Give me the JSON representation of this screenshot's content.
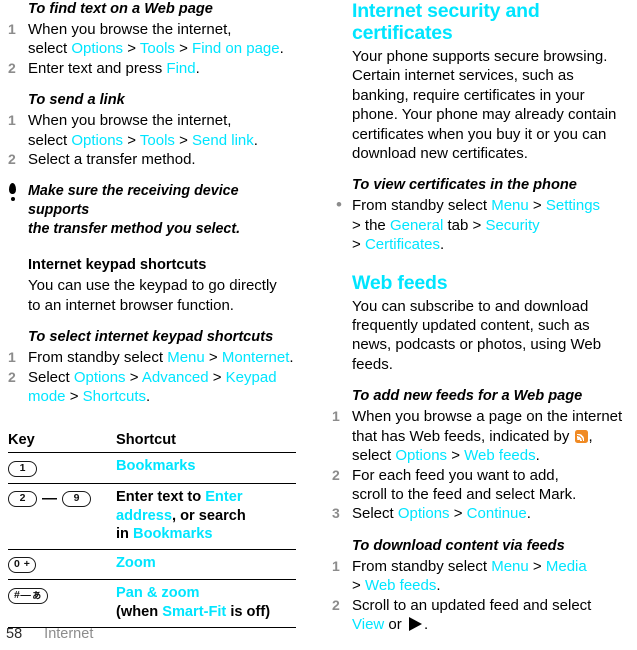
{
  "colors": {
    "accent_cyan": "#00e5ff",
    "step_number_gray": "#8c8c8c",
    "rss_orange": "#f08a24",
    "footer_gray": "#8c8c8c",
    "text_black": "#000000"
  },
  "left_column": {
    "proc_find_text": {
      "heading": "To find text on a Web page",
      "steps": [
        {
          "num": "1",
          "parts": [
            {
              "t": "When you browse the internet,",
              "style": "plain",
              "br": true
            },
            {
              "t": "select ",
              "style": "plain"
            },
            {
              "t": "Options",
              "style": "ui"
            },
            {
              "t": " > ",
              "style": "plain"
            },
            {
              "t": "Tools",
              "style": "ui"
            },
            {
              "t": " > ",
              "style": "plain"
            },
            {
              "t": "Find on page",
              "style": "ui"
            },
            {
              "t": ".",
              "style": "plain"
            }
          ]
        },
        {
          "num": "2",
          "parts": [
            {
              "t": "Enter text and press ",
              "style": "plain"
            },
            {
              "t": "Find",
              "style": "ui"
            },
            {
              "t": ".",
              "style": "plain"
            }
          ]
        }
      ]
    },
    "proc_send_link": {
      "heading": "To send a link",
      "steps": [
        {
          "num": "1",
          "parts": [
            {
              "t": "When you browse the internet,",
              "style": "plain",
              "br": true
            },
            {
              "t": "select ",
              "style": "plain"
            },
            {
              "t": "Options",
              "style": "ui"
            },
            {
              "t": " > ",
              "style": "plain"
            },
            {
              "t": "Tools",
              "style": "ui"
            },
            {
              "t": " > ",
              "style": "plain"
            },
            {
              "t": "Send link",
              "style": "ui"
            },
            {
              "t": ".",
              "style": "plain"
            }
          ]
        },
        {
          "num": "2",
          "parts": [
            {
              "t": "Select a transfer method.",
              "style": "plain"
            }
          ]
        }
      ]
    },
    "note": {
      "icon": "tip-exclamation-icon",
      "line1": "Make sure the receiving device supports",
      "line2": "the transfer method you select."
    },
    "keypad_shortcuts": {
      "heading": "Internet keypad shortcuts",
      "body_line1": "You can use the keypad to go directly",
      "body_line2": "to an internet browser function."
    },
    "proc_select_keypad": {
      "heading": "To select internet keypad shortcuts",
      "steps": [
        {
          "num": "1",
          "parts": [
            {
              "t": "From standby select ",
              "style": "plain"
            },
            {
              "t": "Menu",
              "style": "ui"
            },
            {
              "t": " > ",
              "style": "plain"
            },
            {
              "t": "Monternet",
              "style": "ui"
            },
            {
              "t": ".",
              "style": "plain"
            }
          ]
        },
        {
          "num": "2",
          "parts": [
            {
              "t": "Select ",
              "style": "plain"
            },
            {
              "t": "Options",
              "style": "ui"
            },
            {
              "t": " > ",
              "style": "plain"
            },
            {
              "t": "Advanced",
              "style": "ui"
            },
            {
              "t": " > ",
              "style": "plain"
            },
            {
              "t": "Keypad",
              "style": "ui"
            },
            {
              "t": "",
              "style": "plain",
              "br": true
            },
            {
              "t": "mode",
              "style": "ui"
            },
            {
              "t": " > ",
              "style": "plain"
            },
            {
              "t": "Shortcuts",
              "style": "ui"
            },
            {
              "t": ".",
              "style": "plain"
            }
          ]
        }
      ]
    },
    "key_table": {
      "headers": [
        "Key",
        "Shortcut"
      ],
      "rows": [
        {
          "keys": [
            {
              "type": "cap",
              "label": "1"
            }
          ],
          "shortcut_parts": [
            {
              "t": "Bookmarks",
              "style": "ui"
            }
          ]
        },
        {
          "keys": [
            {
              "type": "cap",
              "label": "2"
            },
            {
              "type": "dash",
              "label": "—"
            },
            {
              "type": "cap",
              "label": "9"
            }
          ],
          "shortcut_parts": [
            {
              "t": "Enter text to ",
              "style": "plain"
            },
            {
              "t": "Enter",
              "style": "ui"
            },
            {
              "t": "",
              "style": "plain",
              "br": true
            },
            {
              "t": "address",
              "style": "ui"
            },
            {
              "t": ", or search",
              "style": "plain",
              "br": true
            },
            {
              "t": "in ",
              "style": "plain"
            },
            {
              "t": "Bookmarks",
              "style": "ui"
            }
          ]
        },
        {
          "keys": [
            {
              "type": "cap",
              "label": "0 +"
            }
          ],
          "shortcut_parts": [
            {
              "t": "Zoom",
              "style": "ui"
            }
          ]
        },
        {
          "keys": [
            {
              "type": "cap",
              "label": "#—ぁ"
            }
          ],
          "shortcut_parts": [
            {
              "t": "Pan & zoom",
              "style": "ui"
            },
            {
              "t": "",
              "style": "plain",
              "br": true
            },
            {
              "t": "(when ",
              "style": "plain"
            },
            {
              "t": "Smart-Fit",
              "style": "ui"
            },
            {
              "t": " is off)",
              "style": "plain"
            }
          ]
        }
      ]
    }
  },
  "right_column": {
    "security": {
      "heading": "Internet security and certificates",
      "body_lines": [
        "Your phone supports secure browsing.",
        "Certain internet services, such as",
        "banking, require certificates in your",
        "phone. Your phone may already contain",
        "certificates when you buy it or you can",
        "download new certificates."
      ]
    },
    "proc_view_certificates": {
      "heading": "To view certificates in the phone",
      "bullet": {
        "marker": "•",
        "parts": [
          {
            "t": "From standby select ",
            "style": "plain"
          },
          {
            "t": "Menu",
            "style": "ui"
          },
          {
            "t": " > ",
            "style": "plain"
          },
          {
            "t": "Settings",
            "style": "ui"
          },
          {
            "t": "",
            "style": "plain",
            "br": true
          },
          {
            "t": "> the ",
            "style": "plain"
          },
          {
            "t": "General",
            "style": "ui"
          },
          {
            "t": " tab > ",
            "style": "plain"
          },
          {
            "t": "Security",
            "style": "ui"
          },
          {
            "t": "",
            "style": "plain",
            "br": true
          },
          {
            "t": "> ",
            "style": "plain"
          },
          {
            "t": "Certificates",
            "style": "ui"
          },
          {
            "t": ".",
            "style": "plain"
          }
        ]
      }
    },
    "web_feeds": {
      "heading": "Web feeds",
      "body_lines": [
        "You can subscribe to and download",
        "frequently updated content, such as",
        "news, podcasts or photos, using Web",
        "feeds."
      ]
    },
    "proc_add_feeds": {
      "heading": "To add new feeds for a Web page",
      "steps": [
        {
          "num": "1",
          "parts": [
            {
              "t": "When you browse a page on the internet",
              "style": "plain",
              "br": true
            },
            {
              "t": "that has Web feeds, indicated by ",
              "style": "plain"
            },
            {
              "t": "",
              "style": "rss-icon"
            },
            {
              "t": ",",
              "style": "plain",
              "br": true
            },
            {
              "t": "select ",
              "style": "plain"
            },
            {
              "t": "Options",
              "style": "ui"
            },
            {
              "t": " > ",
              "style": "plain"
            },
            {
              "t": "Web feeds",
              "style": "ui"
            },
            {
              "t": ".",
              "style": "plain"
            }
          ]
        },
        {
          "num": "2",
          "parts": [
            {
              "t": "For each feed you want to add,",
              "style": "plain",
              "br": true
            },
            {
              "t": "scroll to the feed and select Mark.",
              "style": "plain"
            }
          ]
        },
        {
          "num": "3",
          "parts": [
            {
              "t": "Select ",
              "style": "plain"
            },
            {
              "t": "Options",
              "style": "ui"
            },
            {
              "t": " > ",
              "style": "plain"
            },
            {
              "t": "Continue",
              "style": "ui"
            },
            {
              "t": ".",
              "style": "plain"
            }
          ]
        }
      ]
    },
    "proc_download_feeds": {
      "heading": "To download content via feeds",
      "steps": [
        {
          "num": "1",
          "parts": [
            {
              "t": "From standby select ",
              "style": "plain"
            },
            {
              "t": "Menu",
              "style": "ui"
            },
            {
              "t": " > ",
              "style": "plain"
            },
            {
              "t": "Media",
              "style": "ui"
            },
            {
              "t": "",
              "style": "plain",
              "br": true
            },
            {
              "t": "> ",
              "style": "plain"
            },
            {
              "t": "Web feeds",
              "style": "ui"
            },
            {
              "t": ".",
              "style": "plain"
            }
          ]
        },
        {
          "num": "2",
          "parts": [
            {
              "t": "Scroll to an updated feed and select",
              "style": "plain",
              "br": true
            },
            {
              "t": "View",
              "style": "ui"
            },
            {
              "t": " or ",
              "style": "plain"
            },
            {
              "t": "",
              "style": "play-icon"
            },
            {
              "t": ".",
              "style": "plain"
            }
          ]
        }
      ]
    }
  },
  "footer": {
    "page_number": "58",
    "section": "Internet"
  }
}
